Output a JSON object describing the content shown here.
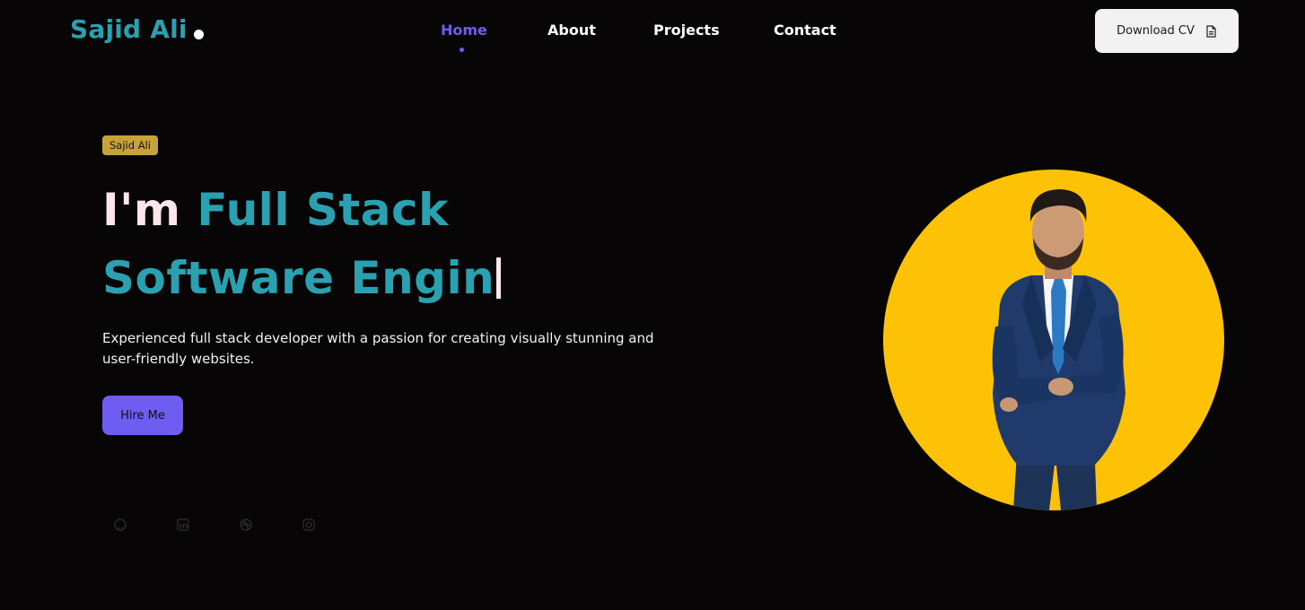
{
  "header": {
    "logo_text": "Sajid Ali",
    "nav": [
      {
        "label": "Home",
        "active": true
      },
      {
        "label": "About",
        "active": false
      },
      {
        "label": "Projects",
        "active": false
      },
      {
        "label": "Contact",
        "active": false
      }
    ],
    "cv_button_label": "Download CV",
    "cv_icon": "document-icon"
  },
  "hero": {
    "badge": "Sajid Ali",
    "headline_lead": "I'm ",
    "headline_role": "Full Stack Software Engin",
    "description": "Experienced full stack developer with a passion for creating visually stunning and user-friendly websites.",
    "hire_button_label": "Hire Me",
    "social_icons": [
      "github-icon",
      "linkedin-icon",
      "dribbble-icon",
      "instagram-icon"
    ]
  },
  "colors": {
    "background": "#070506",
    "brand_teal": "#2aa1b0",
    "accent_purple": "#6f5cf0",
    "badge_gold": "#c7a13a",
    "portrait_yellow": "#fdc106"
  }
}
